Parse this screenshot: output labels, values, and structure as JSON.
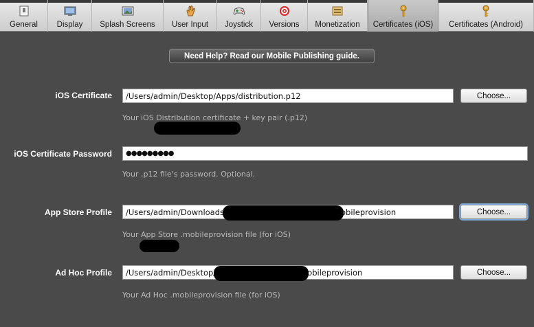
{
  "tabs": [
    {
      "label": "General",
      "icon": "document-icon",
      "width": 70
    },
    {
      "label": "Display",
      "icon": "monitor-icon",
      "width": 64
    },
    {
      "label": "Splash Screens",
      "icon": "image-icon",
      "width": 104
    },
    {
      "label": "User Input",
      "icon": "hand-icon",
      "width": 78
    },
    {
      "label": "Joystick",
      "icon": "gamepad-icon",
      "width": 64
    },
    {
      "label": "Versions",
      "icon": "target-icon",
      "width": 68
    },
    {
      "label": "Monetization",
      "icon": "cash-icon",
      "width": 87
    },
    {
      "label": "Certificates (iOS)",
      "icon": "key-icon",
      "width": 103,
      "selected": true
    },
    {
      "label": "Certificates (Android)",
      "icon": "key-icon",
      "width": 139
    }
  ],
  "help_button": "Need Help? Read our Mobile Publishing guide.",
  "ios_certificate": {
    "label": "iOS Certificate",
    "value": "/Users/admin/Desktop/Apps/distribution.p12",
    "hint": "Your iOS Distribution certificate + key pair (.p12)",
    "choose": "Choose..."
  },
  "ios_password": {
    "label": "iOS Certificate Password",
    "value": "●●●●●●●●●",
    "hint": "Your .p12 file's password. Optional."
  },
  "app_store_profile": {
    "label": "App Store Profile",
    "value": "/Users/admin/Downloads",
    "value_suffix": "obileprovision",
    "hint": "Your App Store .mobileprovision file (for iOS)",
    "choose": "Choose..."
  },
  "ad_hoc_profile": {
    "label": "Ad Hoc Profile",
    "value": "/Users/admin/Desktop/",
    "value_suffix": "obileprovision",
    "hint": "Your Ad Hoc .mobileprovision file (for iOS)",
    "choose": "Choose..."
  }
}
